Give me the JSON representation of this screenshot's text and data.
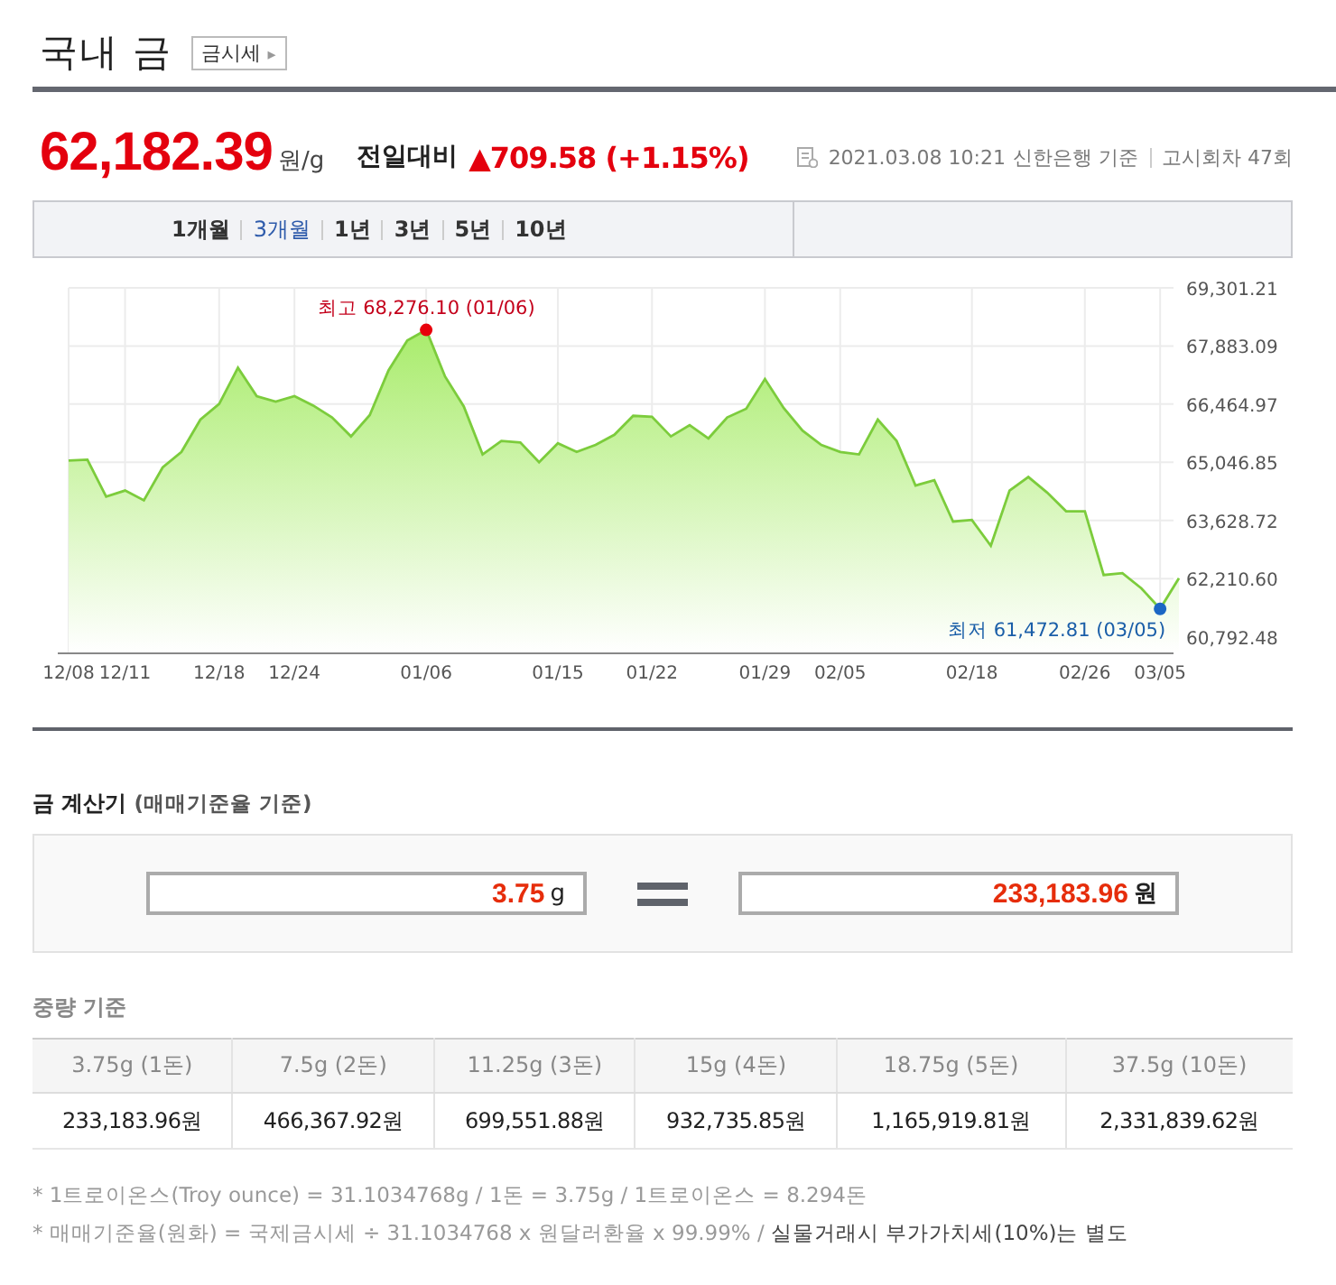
{
  "header": {
    "title": "국내 금",
    "link": "금시세",
    "link_arrow": "▸"
  },
  "price": {
    "value": "62,182.39",
    "unit": "원/g",
    "change_label": "전일대비",
    "change": "▲709.58 (+1.15%)",
    "timestamp": "2021.03.08 10:21",
    "source": "신한은행 기준",
    "round": "고시회차 47회"
  },
  "periods": [
    {
      "label": "1개월",
      "selected": false
    },
    {
      "label": "3개월",
      "selected": true
    },
    {
      "label": "1년",
      "selected": false
    },
    {
      "label": "3년",
      "selected": false
    },
    {
      "label": "5년",
      "selected": false
    },
    {
      "label": "10년",
      "selected": false
    }
  ],
  "chart_data": {
    "type": "area",
    "categories": [
      "12/08",
      null,
      null,
      "12/11",
      null,
      null,
      null,
      null,
      "12/18",
      null,
      null,
      null,
      "12/24",
      null,
      null,
      null,
      null,
      null,
      null,
      "01/06",
      null,
      null,
      null,
      null,
      null,
      null,
      "01/15",
      null,
      null,
      null,
      null,
      "01/22",
      null,
      null,
      null,
      null,
      null,
      "01/29",
      null,
      null,
      null,
      "02/05",
      null,
      null,
      null,
      null,
      null,
      null,
      "02/18",
      null,
      null,
      null,
      null,
      null,
      "02/26",
      null,
      null,
      null,
      "03/05",
      null
    ],
    "series": [
      {
        "color": "#7ccc3c",
        "values": [
          65090,
          65110,
          64210,
          64360,
          64120,
          64920,
          65300,
          66090,
          66470,
          67350,
          66660,
          66530,
          66660,
          66430,
          66140,
          65680,
          66200,
          67290,
          68020,
          68276.1,
          67140,
          66410,
          65240,
          65570,
          65530,
          65050,
          65510,
          65300,
          65470,
          65720,
          66180,
          66160,
          65680,
          65950,
          65630,
          66140,
          66350,
          67080,
          66370,
          65820,
          65470,
          65300,
          65240,
          66090,
          65570,
          64480,
          64610,
          63600,
          63640,
          63010,
          64360,
          64690,
          64310,
          63850,
          63850,
          62300,
          62340,
          61970,
          61472.81,
          62220
        ]
      }
    ],
    "ylim": [
      60792.48,
      69301.21
    ],
    "grid": true,
    "yticks": [
      {
        "value": 69301.21,
        "label": "69,301.21"
      },
      {
        "value": 67883.09,
        "label": "67,883.09"
      },
      {
        "value": 66464.97,
        "label": "66,464.97"
      },
      {
        "value": 65046.85,
        "label": "65,046.85"
      },
      {
        "value": 63628.72,
        "label": "63,628.72"
      },
      {
        "value": 62210.6,
        "label": "62,210.60"
      },
      {
        "value": 60792.48,
        "label": "60,792.48"
      }
    ],
    "annotations": [
      {
        "x": "01/06",
        "y": 68276.1,
        "text": "최고 68,276.10 (01/06)"
      },
      {
        "x": "03/05",
        "y": 61472.81,
        "text": "최저 61,472.81 (03/05)"
      }
    ]
  },
  "calculator": {
    "title": "금 계산기",
    "subtitle": "(매매기준율 기준)",
    "weight": "3.75",
    "weight_unit": "g",
    "amount": "233,183.96",
    "amount_unit": "원"
  },
  "weights": {
    "title": "중량 기준",
    "columns": [
      "3.75g (1돈)",
      "7.5g (2돈)",
      "11.25g (3돈)",
      "15g (4돈)",
      "18.75g (5돈)",
      "37.5g (10돈)"
    ],
    "values": [
      "233,183.96원",
      "466,367.92원",
      "699,551.88원",
      "932,735.85원",
      "1,165,919.81원",
      "2,331,839.62원"
    ]
  },
  "notes": [
    "* 1트로이온스(Troy ounce) = 31.1034768g / 1돈 = 3.75g / 1트로이온스 = 8.294돈",
    "* 매매기준율(원화) = 국제금시세 ÷ 31.1034768 x 원달러환율 x 99.99% / **실물거래시 부가가치세(10%)는 별도**"
  ]
}
